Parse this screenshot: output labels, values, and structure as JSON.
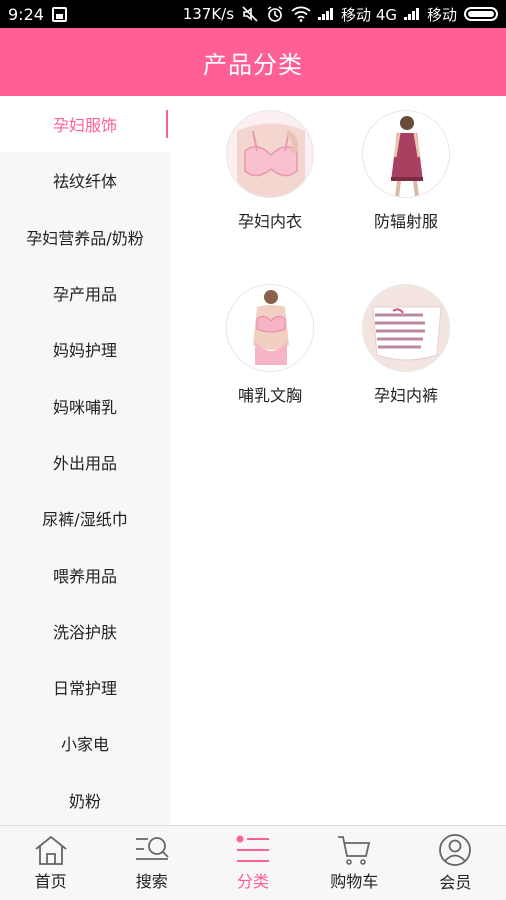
{
  "status_bar": {
    "time": "9:24",
    "speed": "137K/s",
    "carrier1": "移动 4G",
    "carrier2": "移动"
  },
  "header": {
    "title": "产品分类"
  },
  "sidebar": {
    "items": [
      {
        "label": "孕妇服饰",
        "active": true
      },
      {
        "label": "祛纹纤体"
      },
      {
        "label": "孕妇营养品/奶粉"
      },
      {
        "label": "孕产用品"
      },
      {
        "label": "妈妈护理"
      },
      {
        "label": "妈咪哺乳"
      },
      {
        "label": "外出用品"
      },
      {
        "label": "尿裤/湿纸巾"
      },
      {
        "label": "喂养用品"
      },
      {
        "label": "洗浴护肤"
      },
      {
        "label": "日常护理"
      },
      {
        "label": "小家电"
      },
      {
        "label": "奶粉"
      }
    ]
  },
  "products": [
    {
      "name": "孕妇内衣",
      "icon": "maternity-bra-image"
    },
    {
      "name": "防辐射服",
      "icon": "radiation-dress-image"
    },
    {
      "name": "哺乳文胸",
      "icon": "nursing-bra-image"
    },
    {
      "name": "孕妇内裤",
      "icon": "maternity-panties-image"
    }
  ],
  "bottom_nav": [
    {
      "label": "首页",
      "icon": "home-icon"
    },
    {
      "label": "搜索",
      "icon": "search-icon"
    },
    {
      "label": "分类",
      "icon": "category-icon",
      "active": true
    },
    {
      "label": "购物车",
      "icon": "cart-icon"
    },
    {
      "label": "会员",
      "icon": "member-icon"
    }
  ],
  "colors": {
    "accent": "#ff5f95",
    "sidebar_bg": "#f7f7f7",
    "nav_bg": "#f7f7f7"
  }
}
